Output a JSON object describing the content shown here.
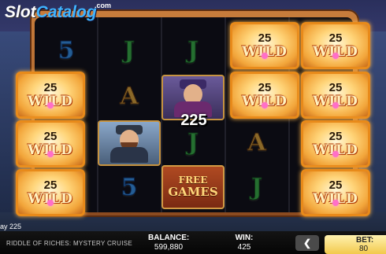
{
  "logo": {
    "part1": "Slot",
    "part2": "Catalog",
    "suffix": ".com"
  },
  "grid": {
    "wild_multiplier": "25",
    "wild_label": "WILD",
    "free_games_line1": "FREE",
    "free_games_line2": "GAMES",
    "symbols": {
      "r0c1": "5",
      "r0c2": "J",
      "r0c3": "J",
      "r1c2": "A",
      "r2c3": "J",
      "r2c4": "A",
      "r3c2": "5",
      "r3c4": "J"
    }
  },
  "win_amount": "225",
  "status": {
    "ways_text": "ay 225"
  },
  "footer": {
    "game_name": "RIDDLE OF RICHES: MYSTERY CRUISE",
    "balance_label": "BALANCE:",
    "balance_value": "599,880",
    "win_label": "WIN:",
    "win_value": "425",
    "prev_label": "❮",
    "bet_label": "BET:",
    "bet_value": "80"
  },
  "colors": {
    "frame": "#c87d3c",
    "wild_border": "#e88a1a",
    "bet_box": "#f2c94c",
    "logo_accent": "#3fb3ff"
  },
  "icons": [
    "chevron-left-icon",
    "gem-icon",
    "captain-portrait",
    "lady-portrait"
  ]
}
